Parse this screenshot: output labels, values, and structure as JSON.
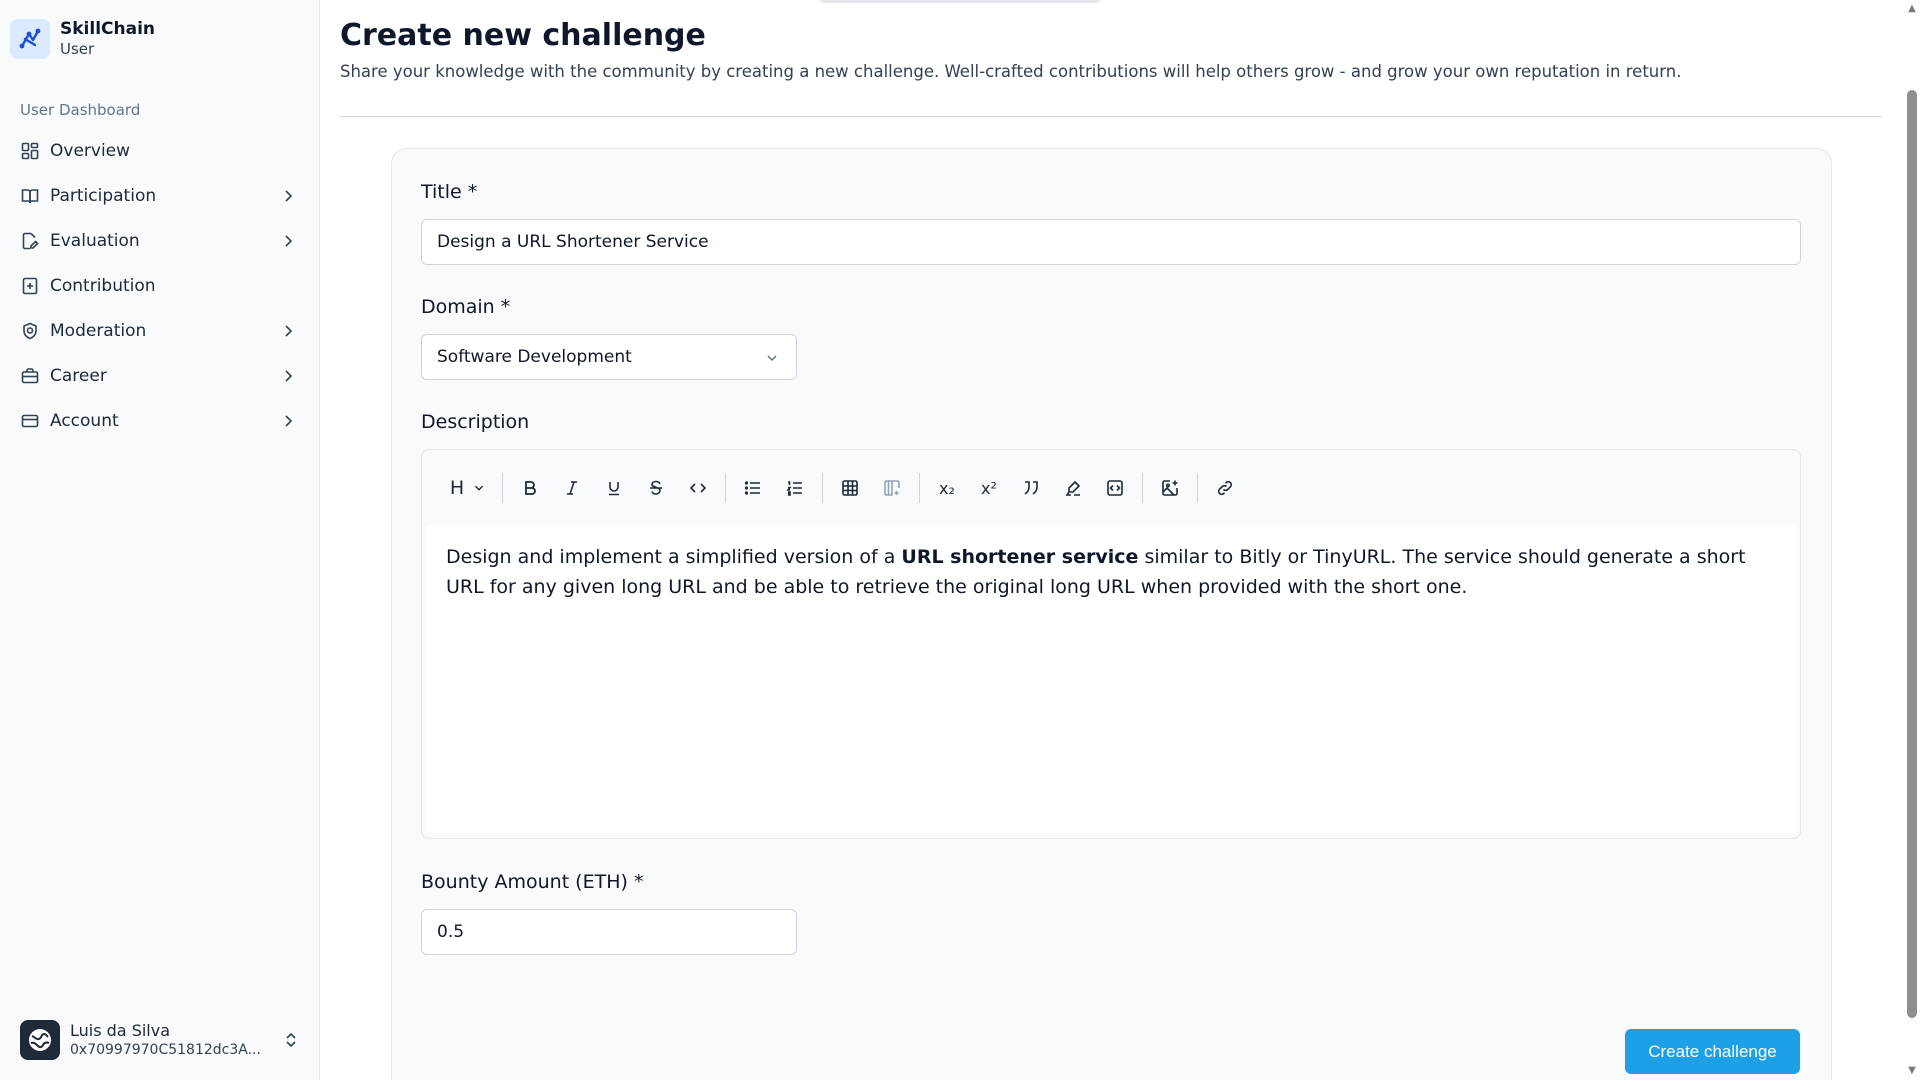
{
  "brand": {
    "name": "SkillChain",
    "role": "User",
    "logo_icon": "skillchain-logo",
    "accent": "#1d4ed8"
  },
  "sidebar": {
    "group_label": "User Dashboard",
    "items": [
      {
        "label": "Overview",
        "icon": "layout-grid-icon",
        "has_submenu": false
      },
      {
        "label": "Participation",
        "icon": "book-open-icon",
        "has_submenu": true
      },
      {
        "label": "Evaluation",
        "icon": "file-edit-icon",
        "has_submenu": true
      },
      {
        "label": "Contribution",
        "icon": "square-plus-icon",
        "has_submenu": false
      },
      {
        "label": "Moderation",
        "icon": "shield-check-icon",
        "has_submenu": true
      },
      {
        "label": "Career",
        "icon": "briefcase-icon",
        "has_submenu": true
      },
      {
        "label": "Account",
        "icon": "credit-card-icon",
        "has_submenu": true
      }
    ]
  },
  "user": {
    "name": "Luis da Silva",
    "address": "0x70997970C51812dc3A..."
  },
  "page": {
    "title": "Create new challenge",
    "subtitle": "Share your knowledge with the community by creating a new challenge. Well-crafted contributions will help others grow - and grow your own reputation in return."
  },
  "form": {
    "title_label": "Title *",
    "title_value": "Design a URL Shortener Service",
    "domain_label": "Domain *",
    "domain_value": "Software Development",
    "description_label": "Description",
    "description": {
      "before": "Design and implement a simplified version of a ",
      "bold": "URL shortener service",
      "after": " similar to Bitly or TinyURL. The service should generate a short URL for any given long URL and be able to retrieve the original long URL when provided with the short one."
    },
    "bounty_label": "Bounty Amount (ETH) *",
    "bounty_value": "0.5",
    "submit_label": "Create challenge"
  },
  "toolbar": {
    "heading": "H",
    "subscript": "x₂",
    "superscript": "x²"
  },
  "colors": {
    "primary_button": "#1ea0e6",
    "sidebar_bg": "#f8fafc"
  }
}
